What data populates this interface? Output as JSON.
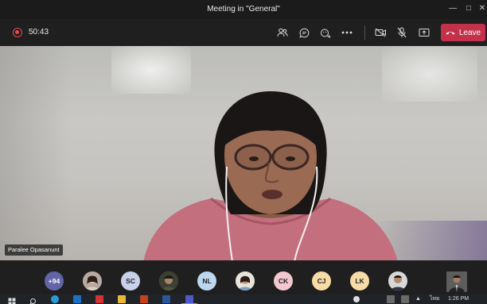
{
  "window": {
    "title": "Meeting in \"General\"",
    "controls": [
      "minimize",
      "maximize",
      "close"
    ]
  },
  "toolbar": {
    "recording_time": "50:43",
    "buttons": [
      {
        "name": "participants-icon"
      },
      {
        "name": "chat-icon"
      },
      {
        "name": "reactions-icon"
      },
      {
        "name": "more-actions-icon"
      },
      {
        "name": "camera-off-icon"
      },
      {
        "name": "mic-off-icon"
      },
      {
        "name": "share-screen-icon"
      }
    ],
    "leave_label": "Leave",
    "leave_color": "#c4314b"
  },
  "stage": {
    "speaker_name": "Paralee Opasanunt"
  },
  "participants": [
    {
      "label": "+94",
      "kind": "overflow",
      "color": "#6264a7"
    },
    {
      "label": "",
      "kind": "photo"
    },
    {
      "label": "SC",
      "kind": "initials",
      "color": "#c8d1ea"
    },
    {
      "label": "",
      "kind": "photo"
    },
    {
      "label": "NL",
      "kind": "initials",
      "color": "#bcd7ee"
    },
    {
      "label": "",
      "kind": "photo"
    },
    {
      "label": "CK",
      "kind": "initials",
      "color": "#f4c6d1"
    },
    {
      "label": "CJ",
      "kind": "initials",
      "color": "#f7dca8"
    },
    {
      "label": "LK",
      "kind": "initials",
      "color": "#f7dca8"
    },
    {
      "label": "",
      "kind": "photo"
    }
  ],
  "taskbar": {
    "clock": "1:26 PM",
    "language": "ไทย",
    "apps": [
      "windows-start-icon",
      "search-icon",
      "edge-icon",
      "mail-icon",
      "app-red-icon",
      "file-explorer-icon",
      "powerpoint-icon",
      "word-icon",
      "teams-icon"
    ]
  }
}
